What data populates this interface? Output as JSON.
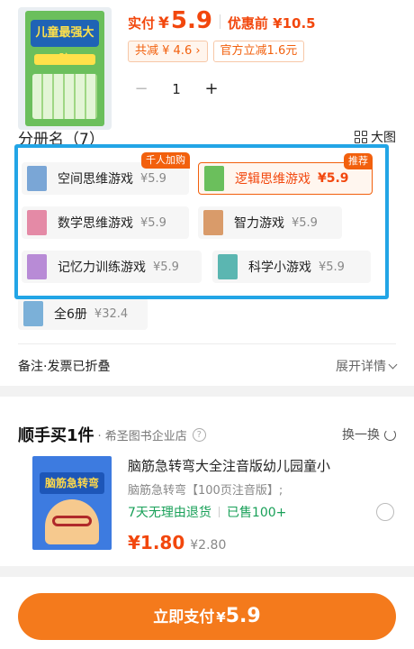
{
  "product": {
    "pay_label": "实付",
    "currency": "¥",
    "pay_amount": "5.9",
    "original_price": "优惠前 ¥10.5",
    "promo_discount": "共减 ¥ 4.6 ›",
    "promo_official": "官方立减1.6元",
    "quantity": "1",
    "minus": "−",
    "plus": "+",
    "thumb_title": "儿童最强大脑"
  },
  "volumes": {
    "title": "分册名（7）",
    "big_view_label": "大图",
    "items": [
      {
        "name": "空间思维游戏",
        "price": "¥5.9",
        "tag": "千人加购",
        "color": "#7aa6d6"
      },
      {
        "name": "逻辑思维游戏",
        "price": "¥5.9",
        "tag": "推荐",
        "color": "#6bbf5c"
      },
      {
        "name": "数学思维游戏",
        "price": "¥5.9",
        "tag": "",
        "color": "#e48aa6"
      },
      {
        "name": "智力游戏",
        "price": "¥5.9",
        "tag": "",
        "color": "#d99b6a"
      },
      {
        "name": "记忆力训练游戏",
        "price": "¥5.9",
        "tag": "",
        "color": "#b88bd6"
      },
      {
        "name": "科学小游戏",
        "price": "¥5.9",
        "tag": "",
        "color": "#5bb6b1"
      },
      {
        "name": "全6册",
        "price": "¥32.4",
        "tag": "",
        "color": "#7bb0d8"
      }
    ]
  },
  "remark": {
    "label": "备注·发票已折叠",
    "expand": "展开详情"
  },
  "recommend": {
    "title": "顺手买1件",
    "shop": "· 希圣图书企业店",
    "help": "?",
    "swap": "换一换",
    "book_title": "脑筋急转弯",
    "name": "脑筋急转弯大全注音版幼儿园童小",
    "subtitle": "脑筋急转弯【100页注音版】;",
    "badge_return": "7天无理由退货",
    "badge_sold": "已售100+",
    "price": "¥1.80",
    "original": "¥2.80"
  },
  "footer": {
    "pay_label": "立即支付",
    "currency": "¥",
    "amount": "5.9"
  },
  "colors": {
    "accent": "#f2470d",
    "button": "#f47a1c",
    "highlight": "#22a5e6",
    "green": "#18a058"
  }
}
